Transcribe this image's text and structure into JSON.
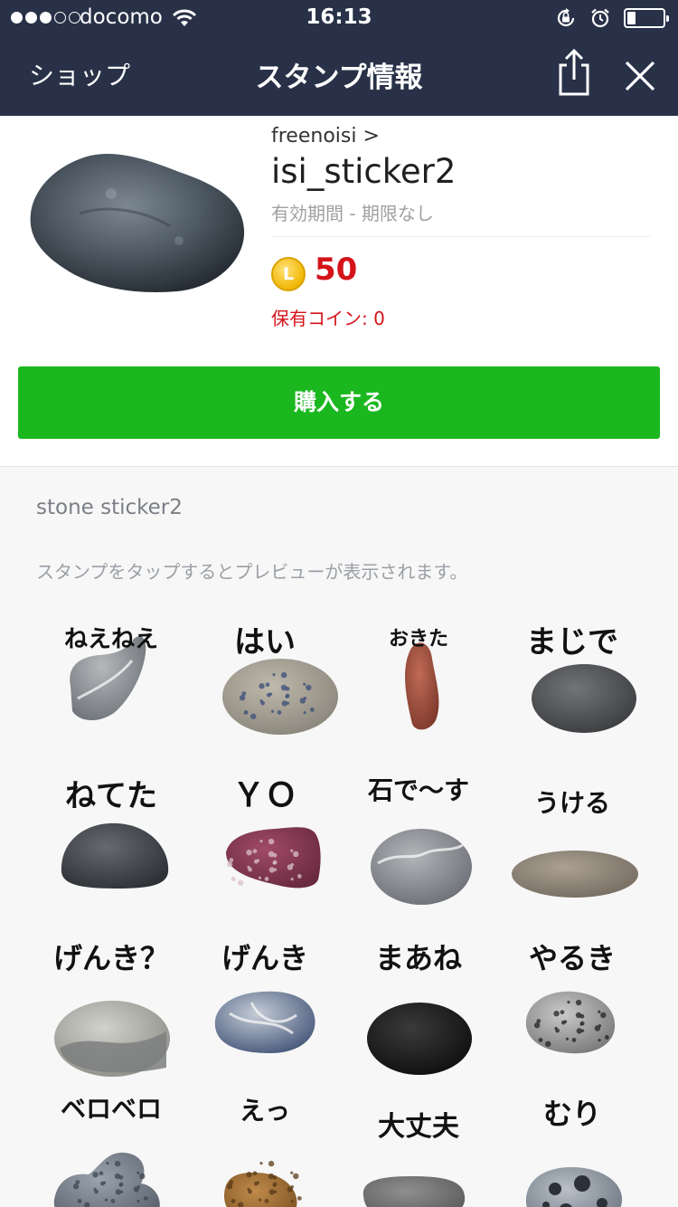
{
  "status_bar": {
    "carrier": "docomo",
    "time": "16:13"
  },
  "nav": {
    "back_label": "ショップ",
    "title": "スタンプ情報"
  },
  "product": {
    "creator": "freenoisi",
    "creator_arrow": ">",
    "title": "isi_sticker2",
    "validity": "有効期間 - 期限なし",
    "coin_symbol": "L",
    "price": "50",
    "owned_coins": "保有コイン: 0",
    "buy_label": "購入する"
  },
  "description": "stone sticker2",
  "preview_hint": "スタンプをタップするとプレビューが表示されます。",
  "stickers": [
    {
      "label": "ねえねえ",
      "stone": "grey-curved"
    },
    {
      "label": "はい",
      "stone": "speckled-oval"
    },
    {
      "label": "おきた",
      "stone": "red-tall"
    },
    {
      "label": "まじで",
      "stone": "dark-round"
    },
    {
      "label": "ねてた",
      "stone": "dark-mound"
    },
    {
      "label": "ＹＯ",
      "stone": "purple-speckled"
    },
    {
      "label": "石で〜す",
      "stone": "veined-white"
    },
    {
      "label": "うける",
      "stone": "flat-grey"
    },
    {
      "label": "げんき？",
      "stone": "two-tone"
    },
    {
      "label": "げんき",
      "stone": "blue-veined"
    },
    {
      "label": "まあね",
      "stone": "black"
    },
    {
      "label": "やるき",
      "stone": "granite"
    },
    {
      "label": "ベロベロ",
      "stone": "porous-grey"
    },
    {
      "label": "えっ",
      "stone": "brown"
    },
    {
      "label": "大丈夫",
      "stone": "flat-long"
    },
    {
      "label": "むり",
      "stone": "holey"
    }
  ],
  "colors": {
    "nav_bg": "#283147",
    "buy_button": "#1bb71f",
    "price": "#d4131b",
    "page_bg": "#f7f7f7"
  }
}
